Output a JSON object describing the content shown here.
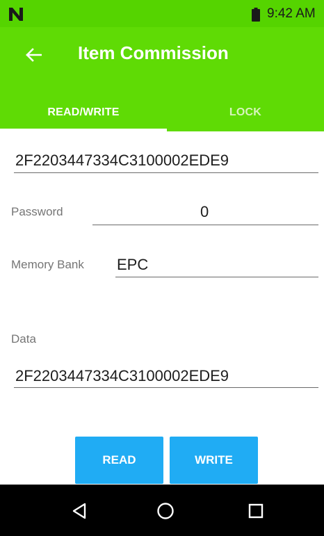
{
  "status_bar": {
    "time": "9:42 AM",
    "logo_icon": "n-logo-icon",
    "battery_icon": "battery-icon",
    "background": "#55d400"
  },
  "app_bar": {
    "title": "Item Commission",
    "back_icon": "arrow-left-icon",
    "background": "#5fdb05"
  },
  "tabs": [
    {
      "label": "READ/WRITE",
      "selected": true
    },
    {
      "label": "LOCK",
      "selected": false
    }
  ],
  "form": {
    "tag_id": "2F2203447334C3100002EDE9",
    "password_label": "Password",
    "password_value": "0",
    "memory_bank_label": "Memory Bank",
    "memory_bank_value": "EPC",
    "data_label": "Data",
    "data_value": "2F2203447334C3100002EDE9"
  },
  "buttons": {
    "read_label": "READ",
    "write_label": "WRITE",
    "color": "#20acf4"
  },
  "nav_bar": {
    "icons": [
      "back-triangle-icon",
      "home-circle-icon",
      "recents-square-icon"
    ]
  }
}
